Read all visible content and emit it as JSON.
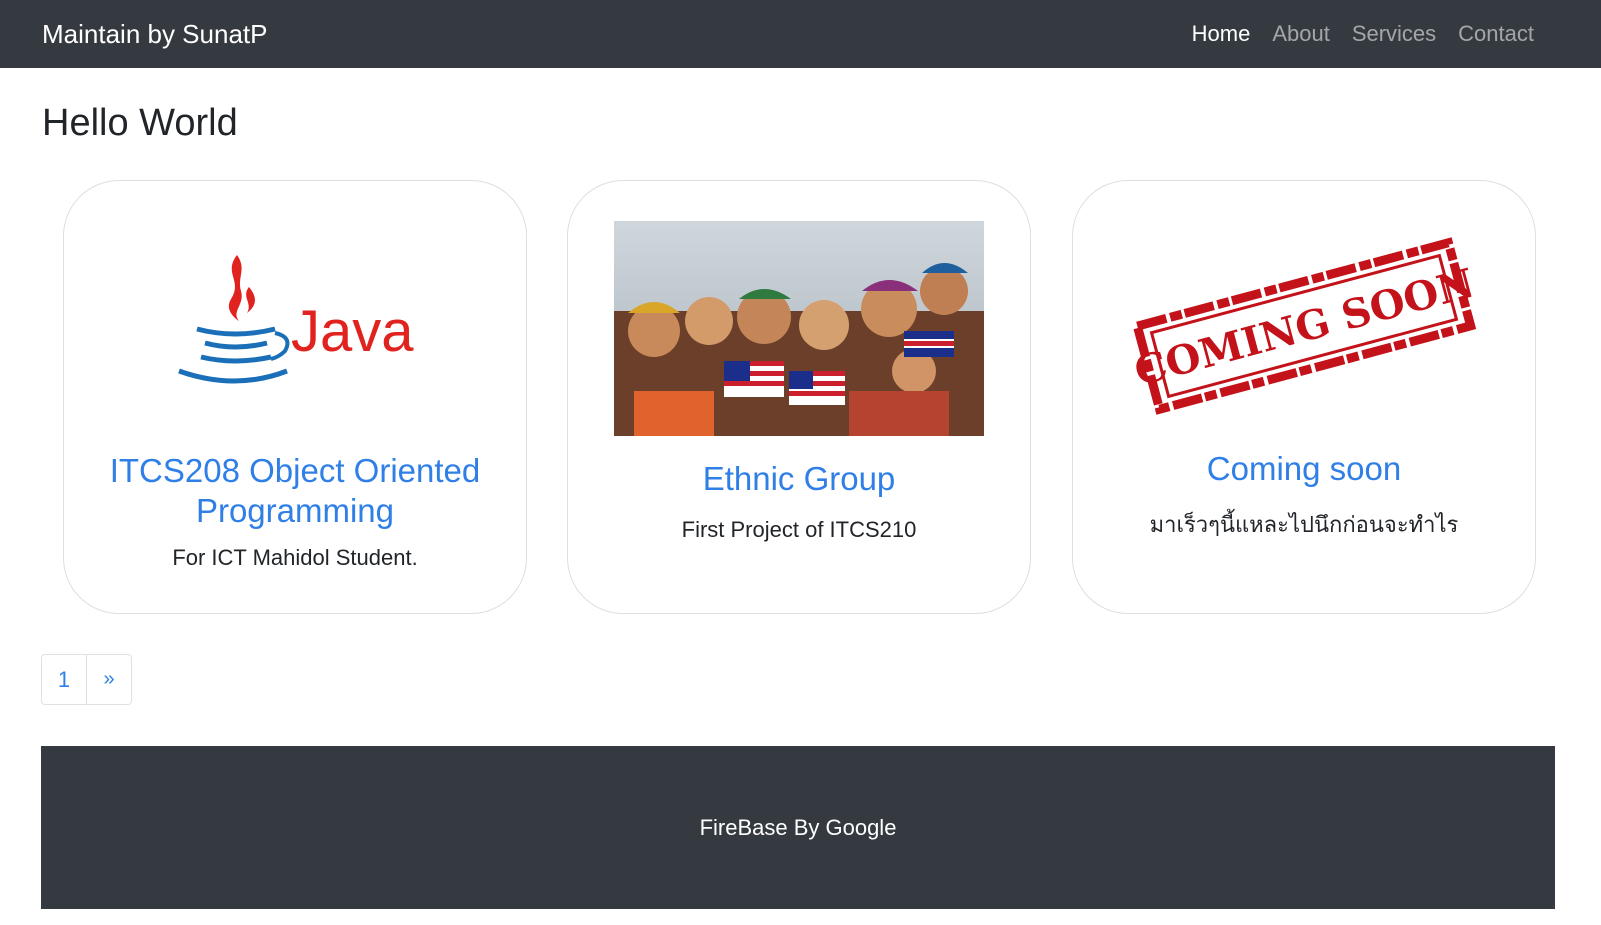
{
  "navbar": {
    "brand": "Maintain by SunatP",
    "links": [
      {
        "label": "Home",
        "active": true
      },
      {
        "label": "About",
        "active": false
      },
      {
        "label": "Services",
        "active": false
      },
      {
        "label": "Contact",
        "active": false
      }
    ]
  },
  "page": {
    "title": "Hello World"
  },
  "cards": [
    {
      "image_icon": "java-logo-icon",
      "image_wordmark": "Java",
      "title_line1": "ITCS208 Object Oriented",
      "title_line2": "Programming",
      "text": "For ICT Mahidol Student."
    },
    {
      "image_icon": "ethnic-group-photo",
      "title": "Ethnic Group",
      "text": "First Project of ITCS210"
    },
    {
      "image_icon": "coming-soon-stamp-icon",
      "image_stamp_text": "COMING SOON",
      "title": "Coming soon",
      "text": "มาเร็วๆนี้แหละไปนึกก่อนจะทำไร"
    }
  ],
  "pagination": {
    "current": "1",
    "next": "»"
  },
  "footer": {
    "text": "FireBase By Google"
  },
  "colors": {
    "navbar_bg": "#343a40",
    "link": "#2f7fe6",
    "java_red": "#e1231f",
    "java_blue": "#1a6fb8",
    "stamp_red": "#c4121a"
  }
}
